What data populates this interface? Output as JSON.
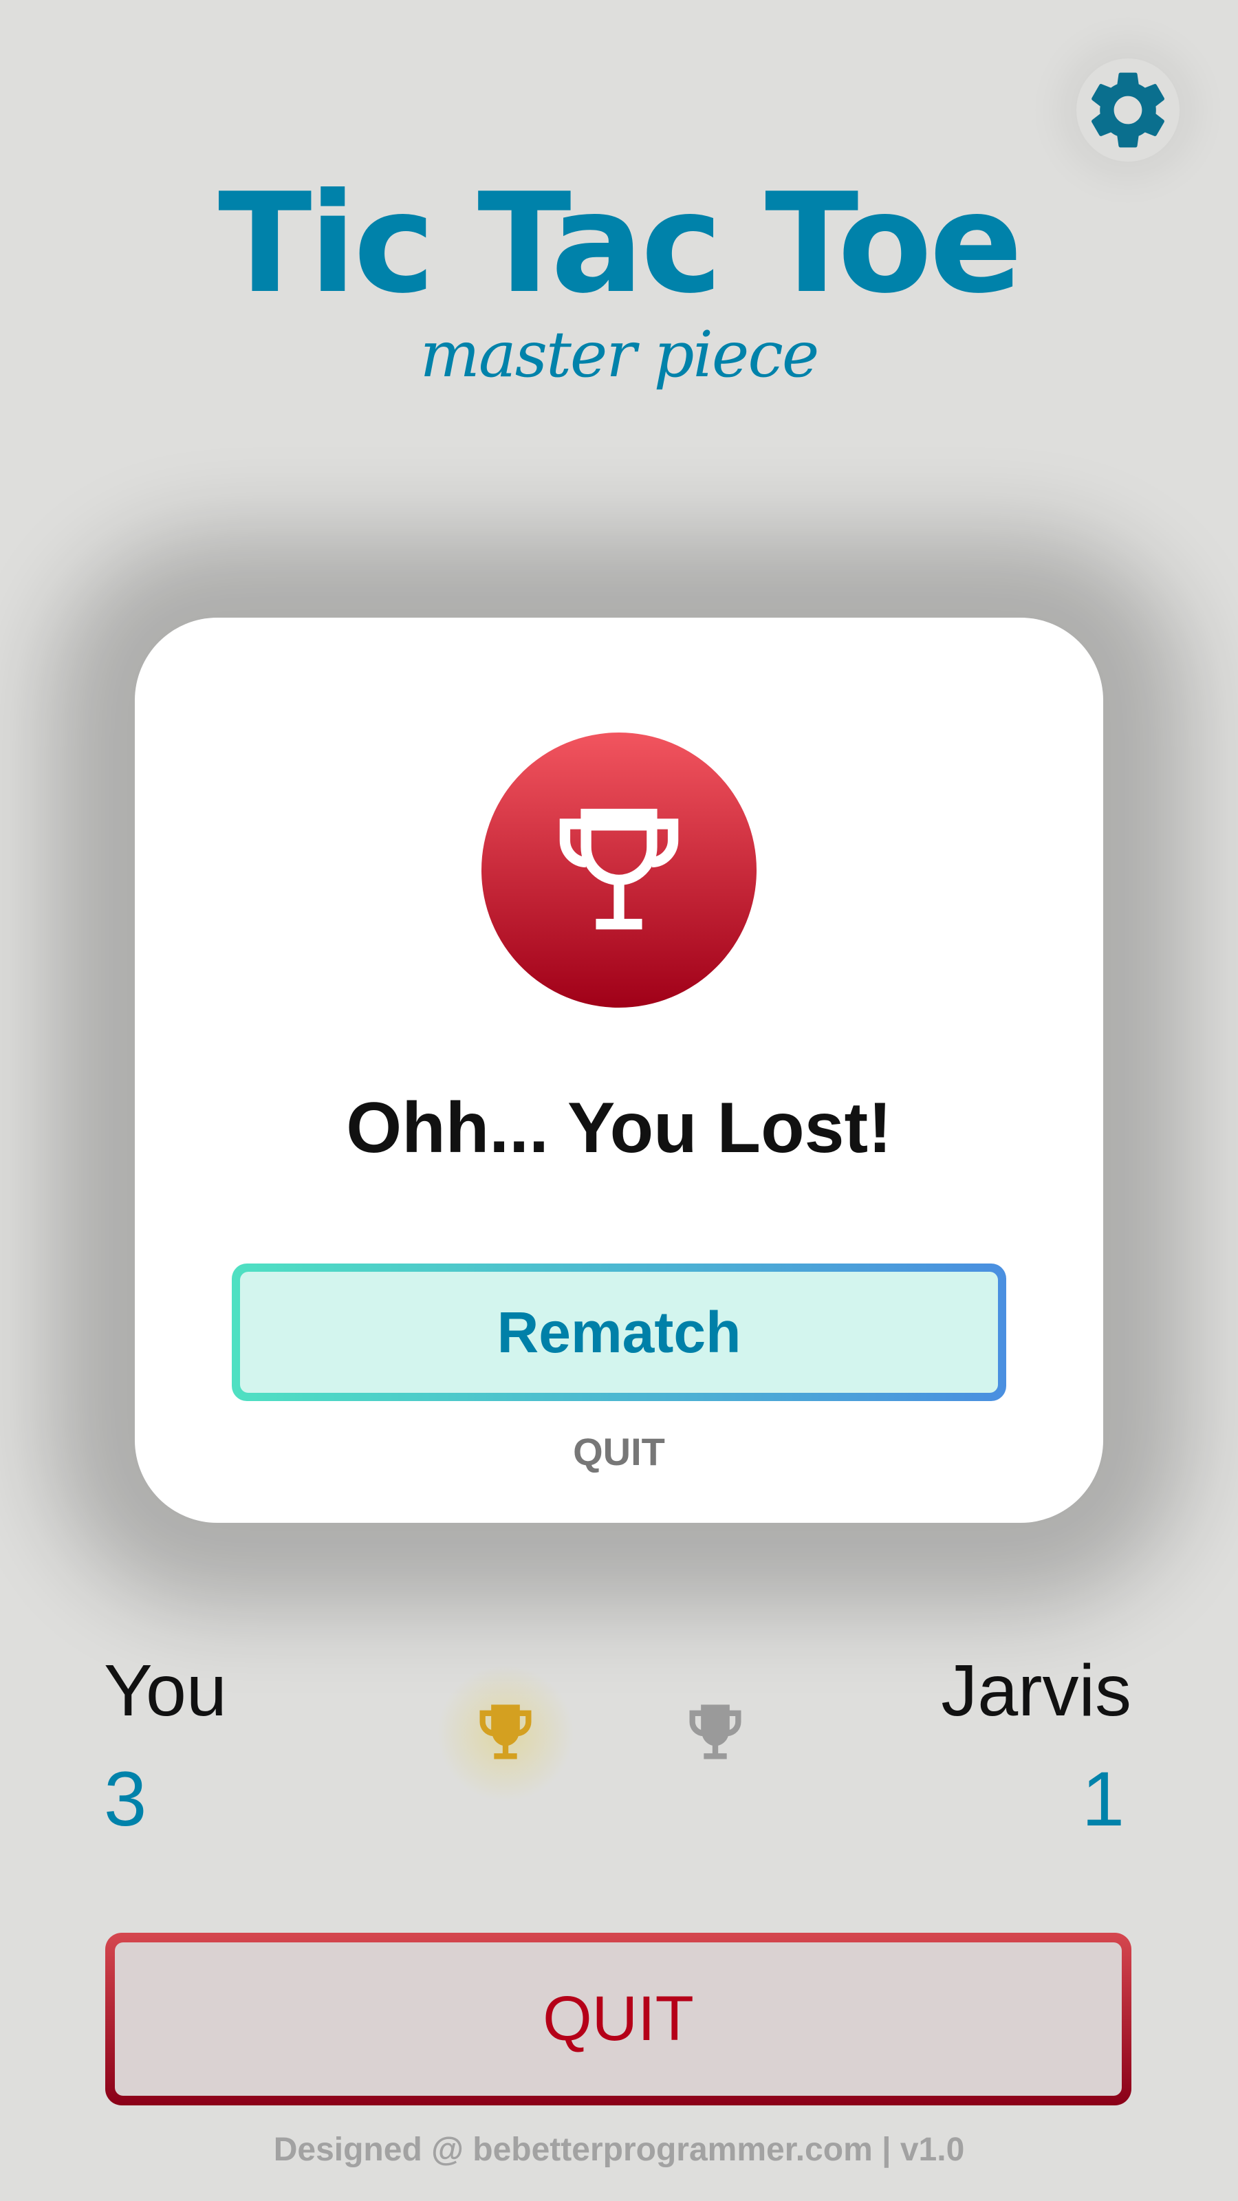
{
  "header": {
    "title": "Tic Tac Toe",
    "subtitle": "master piece",
    "settings_icon": "gear-icon"
  },
  "modal": {
    "icon": "trophy-icon",
    "message": "Ohh... You Lost!",
    "rematch_label": "Rematch",
    "quit_label": "QUIT"
  },
  "scoreboard": {
    "player1": {
      "name": "You",
      "score": "3"
    },
    "player2": {
      "name": "Jarvis",
      "score": "1"
    }
  },
  "quit_button": {
    "label": "QUIT"
  },
  "footer": {
    "text": "Designed @ bebetterprogrammer.com | v1.0"
  },
  "colors": {
    "accent": "#0082aa",
    "danger": "#b50018",
    "gold": "#d4a020",
    "muted": "#9a9a9a"
  }
}
